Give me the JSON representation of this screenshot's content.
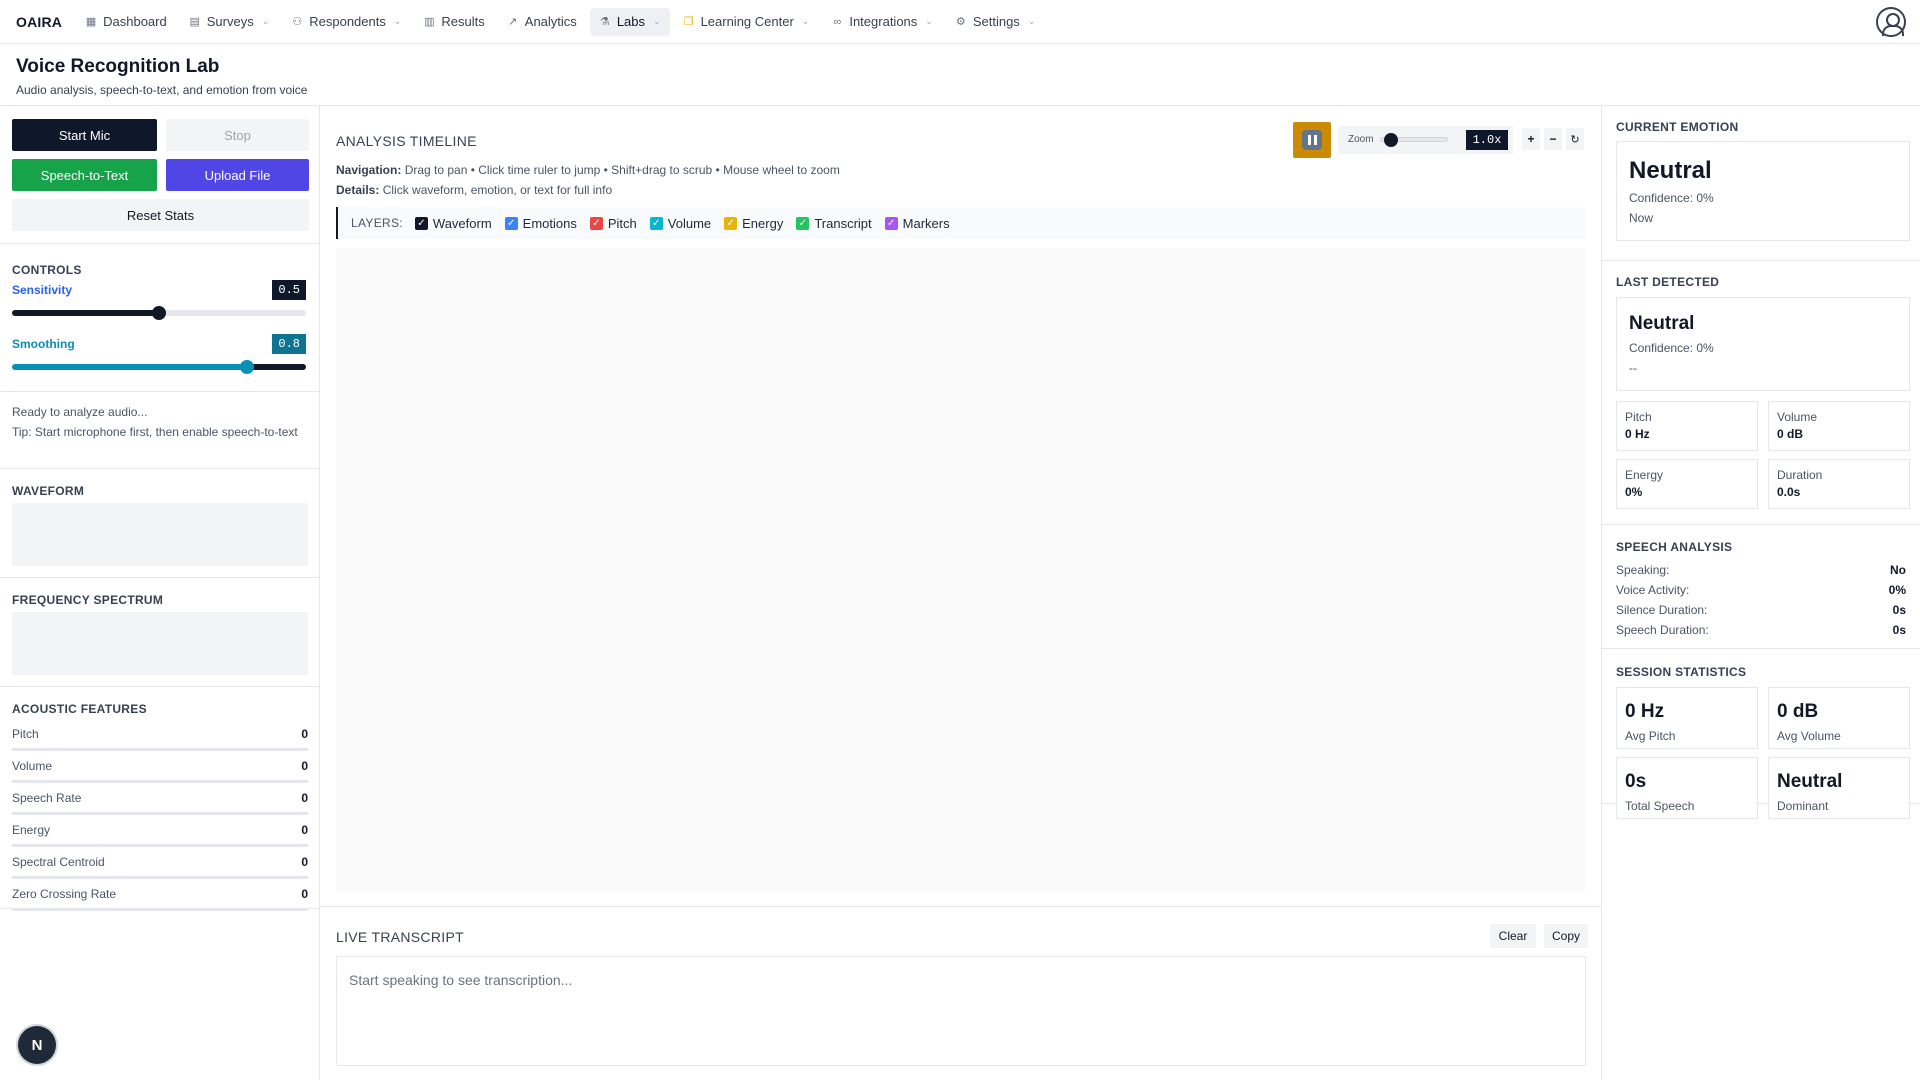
{
  "nav": {
    "brand": "OAIRA",
    "items": [
      {
        "label": "Dashboard",
        "icon": "grid-icon",
        "dropdown": false,
        "active": false
      },
      {
        "label": "Surveys",
        "icon": "document-icon",
        "dropdown": true,
        "active": false
      },
      {
        "label": "Respondents",
        "icon": "users-icon",
        "dropdown": true,
        "active": false
      },
      {
        "label": "Results",
        "icon": "bar-chart-icon",
        "dropdown": false,
        "active": false
      },
      {
        "label": "Analytics",
        "icon": "trend-icon",
        "dropdown": false,
        "active": false
      },
      {
        "label": "Labs",
        "icon": "flask-icon",
        "dropdown": true,
        "active": true
      },
      {
        "label": "Learning Center",
        "icon": "book-icon",
        "dropdown": true,
        "active": false
      },
      {
        "label": "Integrations",
        "icon": "link-icon",
        "dropdown": true,
        "active": false
      },
      {
        "label": "Settings",
        "icon": "gear-icon",
        "dropdown": true,
        "active": false
      }
    ]
  },
  "page": {
    "title": "Voice Recognition Lab",
    "subtitle": "Audio analysis, speech-to-text, and emotion from voice"
  },
  "left": {
    "start_mic": "Start Mic",
    "stop": "Stop",
    "speech_to_text": "Speech-to-Text",
    "upload_file": "Upload File",
    "reset_stats": "Reset Stats",
    "controls_title": "CONTROLS",
    "sensitivity_label": "Sensitivity",
    "sensitivity_value": "0.5",
    "smoothing_label": "Smoothing",
    "smoothing_value": "0.8",
    "status_text": "Ready to analyze audio...",
    "tip_text": "Tip: Start microphone first, then enable speech-to-text",
    "waveform_title": "WAVEFORM",
    "spectrum_title": "FREQUENCY SPECTRUM",
    "acoustic_title": "ACOUSTIC FEATURES",
    "features": [
      {
        "label": "Pitch",
        "value": "0"
      },
      {
        "label": "Volume",
        "value": "0"
      },
      {
        "label": "Speech Rate",
        "value": "0"
      },
      {
        "label": "Energy",
        "value": "0"
      },
      {
        "label": "Spectral Centroid",
        "value": "0"
      },
      {
        "label": "Zero Crossing Rate",
        "value": "0"
      }
    ]
  },
  "timeline": {
    "title": "ANALYSIS TIMELINE",
    "zoom_label": "Zoom",
    "zoom_value": "1.0x",
    "zoom_level": 0.05,
    "nav_label": "Navigation:",
    "nav_text": "Drag to pan • Click time ruler to jump • Shift+drag to scrub • Mouse wheel to zoom",
    "details_label": "Details:",
    "details_text": "Click waveform, emotion, or text for full info",
    "layers_label": "LAYERS:",
    "layers": [
      {
        "label": "Waveform",
        "color": "#111827"
      },
      {
        "label": "Emotions",
        "color": "#3b82f6"
      },
      {
        "label": "Pitch",
        "color": "#ef4444"
      },
      {
        "label": "Volume",
        "color": "#06b6d4"
      },
      {
        "label": "Energy",
        "color": "#eab308"
      },
      {
        "label": "Transcript",
        "color": "#22c55e"
      },
      {
        "label": "Markers",
        "color": "#a855f7"
      }
    ]
  },
  "transcript": {
    "title": "LIVE TRANSCRIPT",
    "clear": "Clear",
    "copy": "Copy",
    "placeholder": "Start speaking to see transcription..."
  },
  "right": {
    "current_title": "CURRENT EMOTION",
    "current_emotion": "Neutral",
    "current_conf": "Confidence: 0%",
    "current_time": "Now",
    "last_title": "LAST DETECTED",
    "last_emotion": "Neutral",
    "last_conf": "Confidence: 0%",
    "last_time": "--",
    "metrics": [
      {
        "label": "Pitch",
        "value": "0 Hz"
      },
      {
        "label": "Volume",
        "value": "0 dB"
      },
      {
        "label": "Energy",
        "value": "0%"
      },
      {
        "label": "Duration",
        "value": "0.0s"
      }
    ],
    "speech_title": "SPEECH ANALYSIS",
    "speech": [
      {
        "label": "Speaking:",
        "value": "No"
      },
      {
        "label": "Voice Activity:",
        "value": "0%"
      },
      {
        "label": "Silence Duration:",
        "value": "0s"
      },
      {
        "label": "Speech Duration:",
        "value": "0s"
      }
    ],
    "session_title": "SESSION STATISTICS",
    "session": [
      {
        "value": "0 Hz",
        "label": "Avg Pitch"
      },
      {
        "value": "0 dB",
        "label": "Avg Volume"
      },
      {
        "value": "0s",
        "label": "Total Speech"
      },
      {
        "value": "Neutral",
        "label": "Dominant"
      }
    ]
  },
  "colors": {
    "dark": "#0f172a",
    "green": "#16a34a",
    "indigo": "#4f46e5",
    "cyan": "#0891b2",
    "orange": "#ca8a04",
    "blue": "#2563eb"
  },
  "fab_letter": "N"
}
